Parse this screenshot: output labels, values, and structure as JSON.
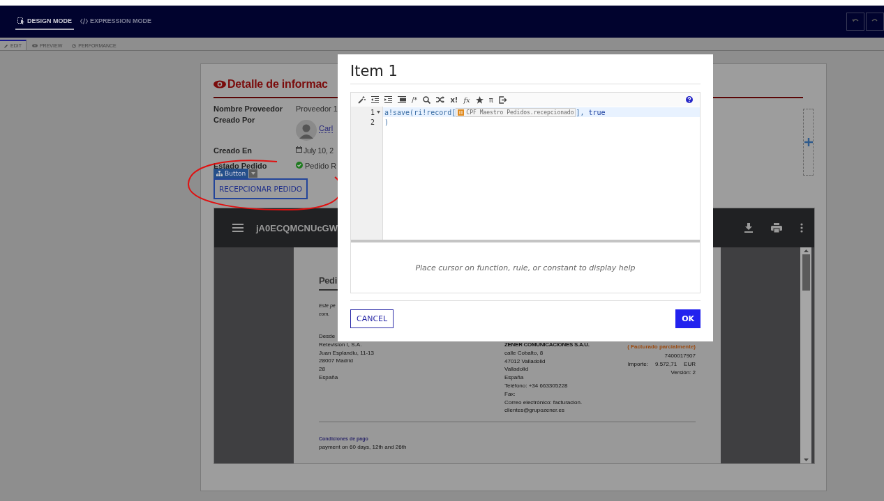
{
  "modes": [
    {
      "label": "DESIGN MODE",
      "selected": true
    },
    {
      "label": "EXPRESSION MODE",
      "selected": false
    }
  ],
  "subtabs": [
    {
      "label": "EDIT",
      "selected": true
    },
    {
      "label": "PREVIEW",
      "selected": false
    },
    {
      "label": "PERFORMANCE",
      "selected": false
    }
  ],
  "card": {
    "title": "Detalle de informac",
    "fields": [
      {
        "kind": "text",
        "label": "Nombre Proveedor",
        "value": "Proveedor 1"
      },
      {
        "kind": "user",
        "label": "Creado Por",
        "value": "Carl"
      },
      {
        "kind": "date",
        "label": "Creado En",
        "value": "July 10, 2"
      },
      {
        "kind": "status",
        "label": "Estado Pedido",
        "value": "Pedido R"
      }
    ],
    "component_tag": "Button",
    "button": "RECEPCIONAR PEDIDO"
  },
  "pdf_viewer": {
    "title": "jA0ECQMCNUcGW",
    "page": {
      "heading": "Pedi",
      "intro": [
        "Este pe",
        "com."
      ],
      "from": [
        "Desde",
        "Retevision I, S.A.",
        "Juan Esplandiu, 11-13",
        "28007 Madrid",
        "28",
        "España"
      ],
      "to_name": "ZENER COMUNICACIONES S.A.U.",
      "to": [
        "calle Cobalto, 8",
        "47012 Valladolid",
        "Valladolid",
        "España",
        "Teléfono: +34 663305228",
        "Fax:",
        "Correo electrónico: facturacion.",
        "clientes@grupozener.es"
      ],
      "doc_status": "( Facturado parcialmente)",
      "doc_number": "7400017907",
      "amount_label": "Importe:",
      "amount": "9.572,71",
      "currency": "EUR",
      "version": "Versión: 2",
      "terms_title": "Condiciones de pago",
      "terms": "payment on 60 days, 12th and 26th"
    }
  },
  "dialog": {
    "title": "Item 1",
    "toolbar_glyphs": [
      "/*",
      "x!",
      "fx",
      "π"
    ],
    "code_lines": [
      {
        "number": "1",
        "foldable": true,
        "parts": [
          {
            "kind": "code",
            "text": "a!save(ri!record["
          },
          {
            "kind": "chip",
            "text": "CPF Maestro Pedidos.recepcionado"
          },
          {
            "kind": "code",
            "text": "], "
          },
          {
            "kind": "keyword",
            "text": "true"
          }
        ]
      },
      {
        "number": "2",
        "foldable": false,
        "parts": [
          {
            "kind": "code",
            "text": ")"
          }
        ]
      }
    ],
    "help": "Place cursor on function, rule, or constant to display help",
    "cancel": "CANCEL",
    "ok": "OK"
  }
}
